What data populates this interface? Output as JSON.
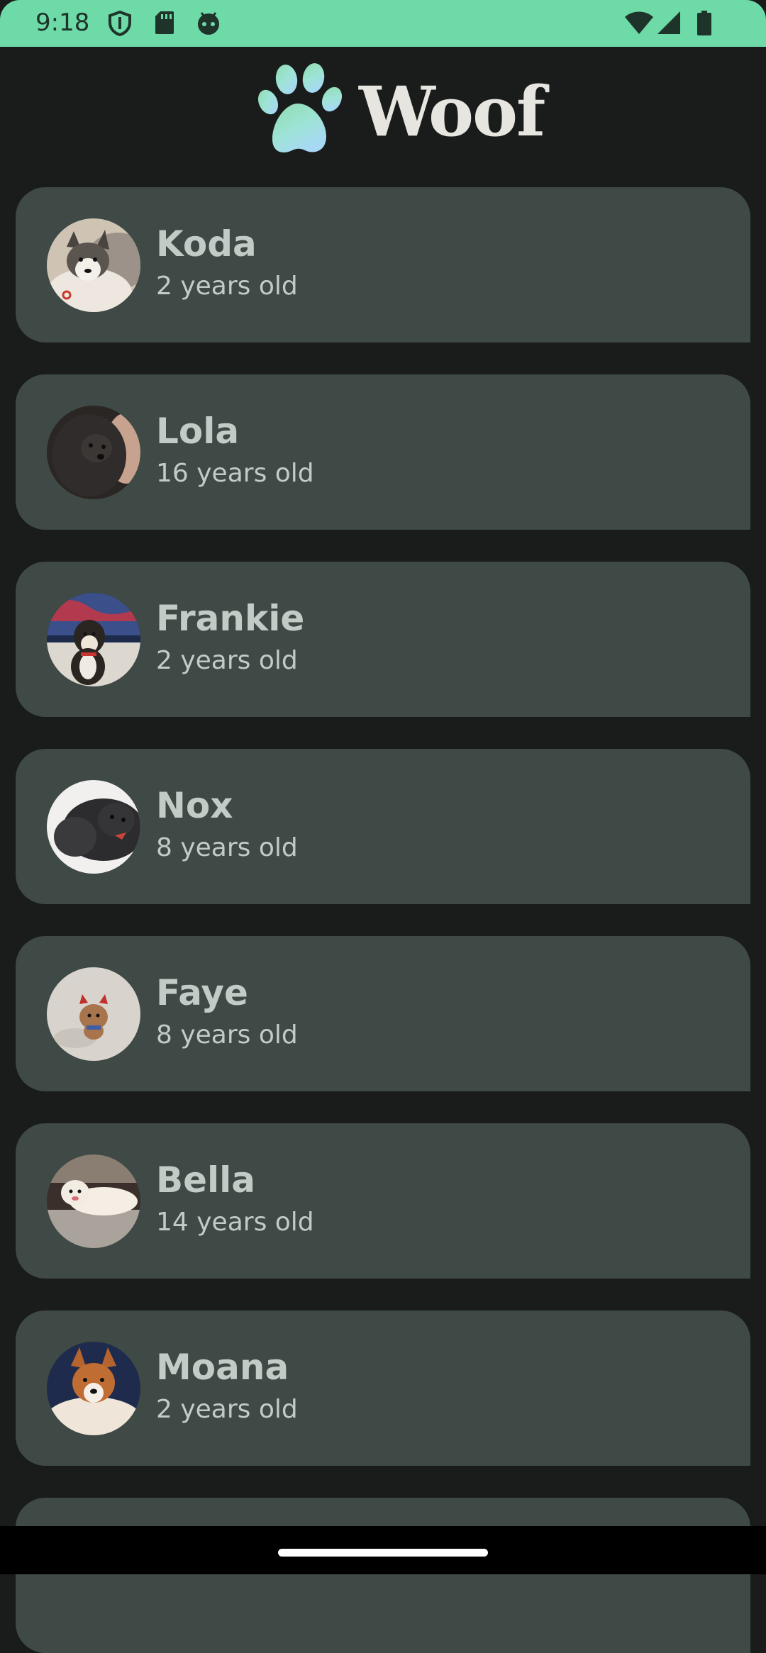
{
  "status_bar": {
    "time": "9:18",
    "icons": [
      "shield-icon",
      "sd-card-icon",
      "android-debug-icon",
      "wifi-icon",
      "cell-signal-icon",
      "battery-icon"
    ],
    "color": "#6ddaa8"
  },
  "app_bar": {
    "title": "Woof",
    "logo": "paw-icon"
  },
  "dogs": [
    {
      "name": "Koda",
      "age": "2 years old"
    },
    {
      "name": "Lola",
      "age": "16 years old"
    },
    {
      "name": "Frankie",
      "age": "2 years old"
    },
    {
      "name": "Nox",
      "age": "8 years old"
    },
    {
      "name": "Faye",
      "age": "8 years old"
    },
    {
      "name": "Bella",
      "age": "14 years old"
    },
    {
      "name": "Moana",
      "age": "2 years old"
    }
  ],
  "colors": {
    "background": "#191c1b",
    "card": "#3f4945",
    "text": "#c3cbc6",
    "accent": "#6ddaa8"
  }
}
